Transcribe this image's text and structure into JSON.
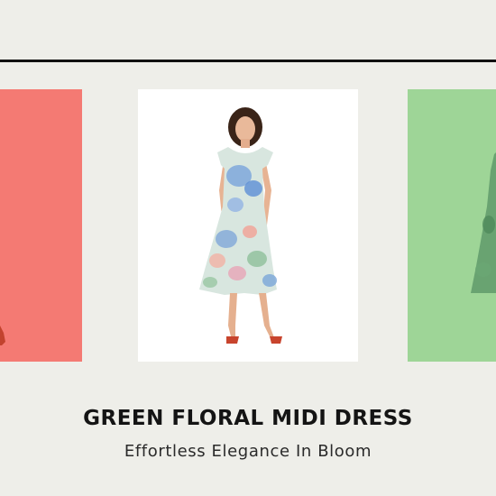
{
  "product": {
    "title": "GREEN FLORAL MIDI DRESS",
    "subtitle": "Effortless Elegance In Bloom"
  },
  "carousel": {
    "slides": [
      {
        "position": "previous",
        "background": "#f47a73"
      },
      {
        "position": "current",
        "background": "#ffffff"
      },
      {
        "position": "next",
        "background": "#9ed597"
      }
    ]
  },
  "colors": {
    "page_background": "#eeeee9",
    "rule": "#111111",
    "title_text": "#141414"
  }
}
